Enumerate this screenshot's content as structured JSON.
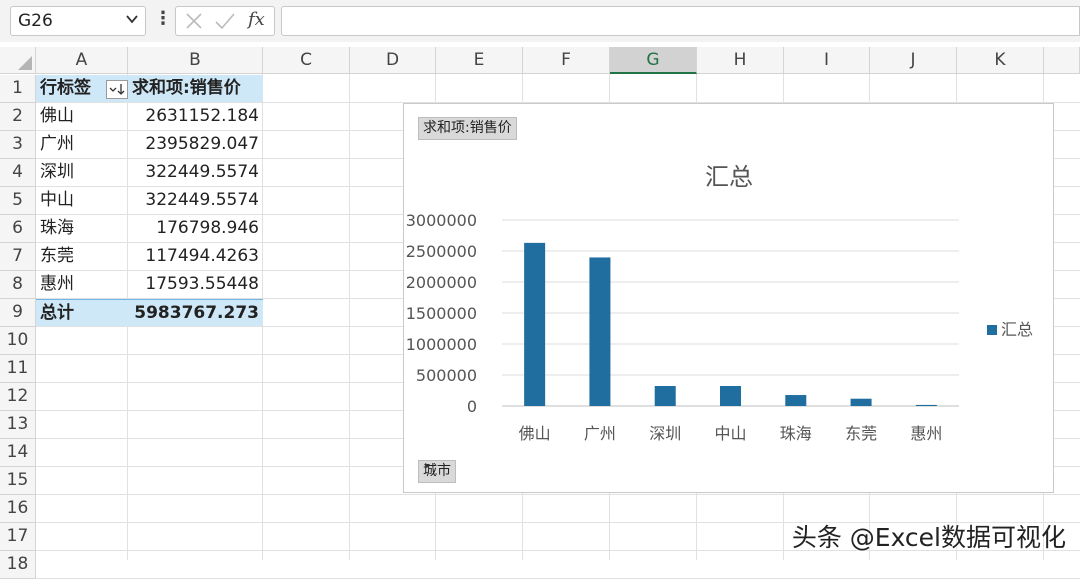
{
  "formula_bar": {
    "name_box": "G26",
    "fx_label": "fx",
    "formula": ""
  },
  "columns": [
    "A",
    "B",
    "C",
    "D",
    "E",
    "F",
    "G",
    "H",
    "I",
    "J",
    "K"
  ],
  "selected_column": "G",
  "rows": [
    "1",
    "2",
    "3",
    "4",
    "5",
    "6",
    "7",
    "8",
    "9",
    "10",
    "11",
    "12",
    "13",
    "14",
    "15",
    "16",
    "17",
    "18"
  ],
  "pivot": {
    "row_label_header": "行标签",
    "value_header": "求和项:销售价",
    "rows": [
      {
        "label": "佛山",
        "value": "2631152.184"
      },
      {
        "label": "广州",
        "value": "2395829.047"
      },
      {
        "label": "深圳",
        "value": "322449.5574"
      },
      {
        "label": "中山",
        "value": "322449.5574"
      },
      {
        "label": "珠海",
        "value": "176798.946"
      },
      {
        "label": "东莞",
        "value": "117494.4263"
      },
      {
        "label": "惠州",
        "value": "17593.55448"
      }
    ],
    "total_label": "总计",
    "total_value": "5983767.273"
  },
  "chart_field_buttons": {
    "value_field": "求和项:销售价",
    "axis_field": "城市"
  },
  "chart_data": {
    "type": "bar",
    "title": "汇总",
    "categories": [
      "佛山",
      "广州",
      "深圳",
      "中山",
      "珠海",
      "东莞",
      "惠州"
    ],
    "series": [
      {
        "name": "汇总",
        "values": [
          2631152.184,
          2395829.047,
          322449.5574,
          322449.5574,
          176798.946,
          117494.4263,
          17593.55448
        ],
        "color": "#1f6e9f"
      }
    ],
    "y_ticks": [
      "0",
      "500000",
      "1000000",
      "1500000",
      "2000000",
      "2500000",
      "3000000"
    ],
    "ylim": [
      0,
      3000000
    ],
    "grid": true,
    "legend_position": "right"
  },
  "watermark": "头条 @Excel数据可视化",
  "colors": {
    "pivot_header_bg": "#cfe8f8",
    "bar": "#1f6e9f",
    "selected_col": "#217346"
  }
}
